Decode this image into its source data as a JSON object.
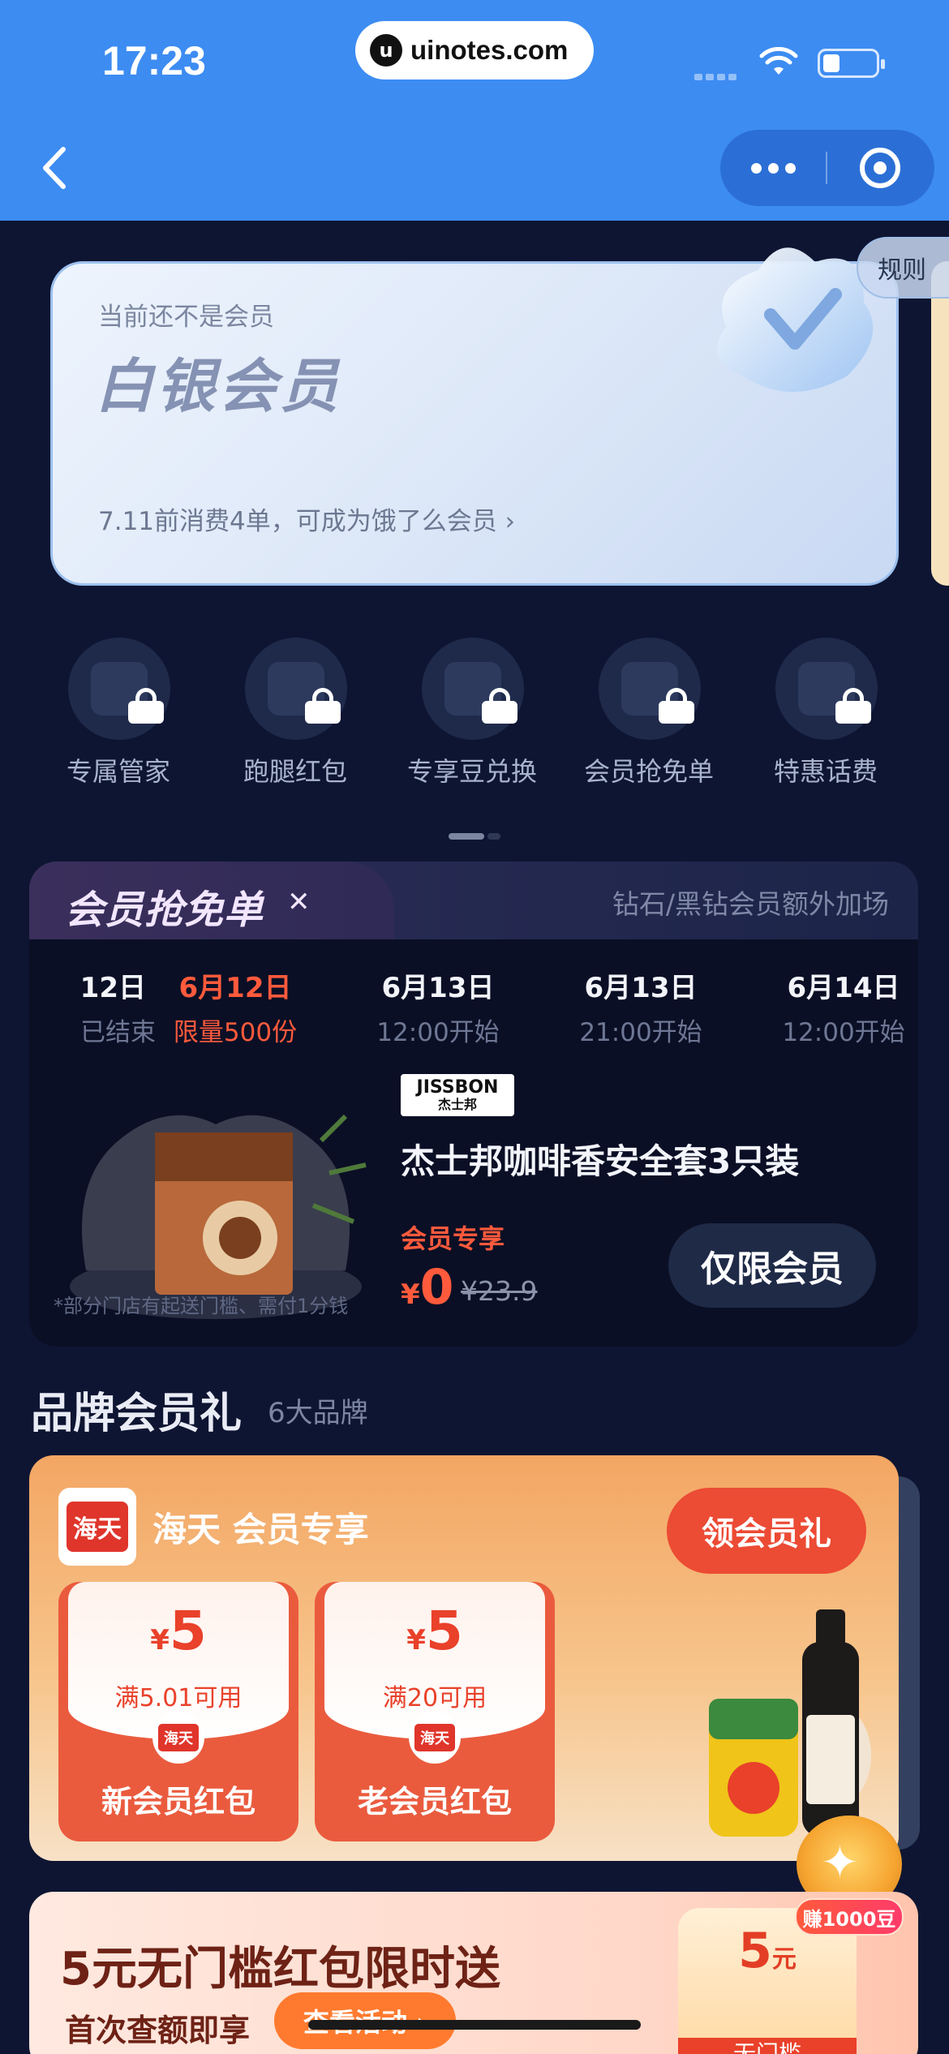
{
  "status_bar": {
    "time": "17:23",
    "url": "uinotes.com"
  },
  "nav": {
    "back_icon": "chevron-left-icon",
    "more_icon": "more-dots-icon",
    "close_icon": "target-icon"
  },
  "member_card": {
    "status": "当前还不是会员",
    "level": "白银会员",
    "hint": "7.11前消费4单，可成为饿了么会员 ›",
    "rules": "规则"
  },
  "benefits": [
    {
      "label": "专属管家",
      "icon": "headset-icon"
    },
    {
      "label": "跑腿红包",
      "icon": "red-packet-icon"
    },
    {
      "label": "专享豆兑换",
      "icon": "bean-exchange-icon"
    },
    {
      "label": "会员抢免单",
      "icon": "gift-icon"
    },
    {
      "label": "特惠话费",
      "icon": "phone-bill-icon"
    }
  ],
  "free_order": {
    "title": "会员抢免单",
    "subtitle": "钻石/黑钻会员额外加场",
    "dates": [
      {
        "date": "12日",
        "status": "已结束"
      },
      {
        "date": "6月12日",
        "status": "限量500份"
      },
      {
        "date": "6月13日",
        "status": "12:00开始"
      },
      {
        "date": "6月13日",
        "status": "21:00开始"
      },
      {
        "date": "6月14日",
        "status": "12:00开始"
      }
    ],
    "product": {
      "brand": "JISSBON",
      "brand_cn": "杰士邦",
      "name": "杰士邦咖啡香安全套3只装",
      "tag": "会员专享",
      "currency": "¥",
      "price": "0",
      "original": "¥23.9",
      "note": "*部分门店有起送门槛、需付1分钱",
      "button": "仅限会员"
    }
  },
  "brand_section": {
    "title": "品牌会员礼",
    "count": "6大品牌",
    "card": {
      "logo": "海天",
      "title": "海天 会员专享",
      "button": "领会员礼",
      "coupons": [
        {
          "currency": "¥",
          "amount": "5",
          "condition": "满5.01可用",
          "seal": "海天",
          "name": "新会员红包"
        },
        {
          "currency": "¥",
          "amount": "5",
          "condition": "满20可用",
          "seal": "海天",
          "name": "老会员红包"
        }
      ]
    }
  },
  "bean_badge": "赚1000豆",
  "promo": {
    "title": "5元无门槛红包限时送",
    "subtitle": "首次查额即享",
    "button": "查看活动 ›",
    "gift_amount": "5",
    "gift_unit": "元",
    "gift_label": "无门槛"
  },
  "colors": {
    "accent": "#3d8cf2",
    "active_date": "#ff5a3c",
    "background": "#0e1532"
  }
}
